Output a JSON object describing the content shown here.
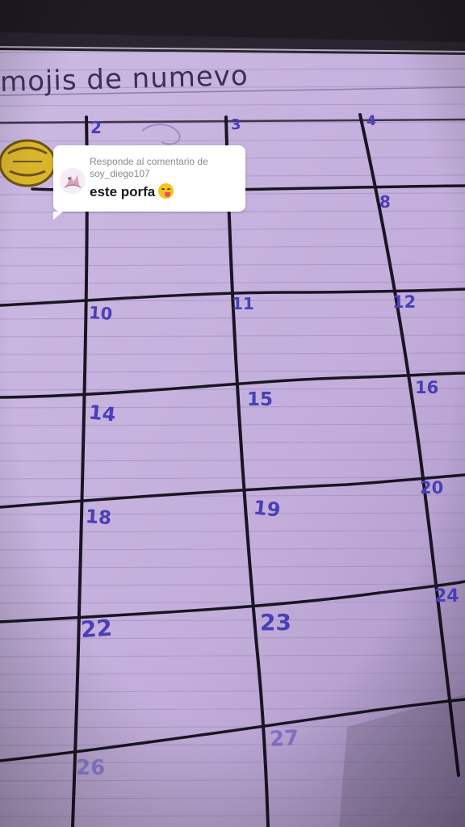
{
  "image": {
    "paper_heading": "mojis de numevo",
    "cell_numbers": [
      "2",
      "3",
      "4",
      "8",
      "10",
      "11",
      "12",
      "14",
      "15",
      "16",
      "18",
      "19",
      "20",
      "22",
      "23",
      "24",
      "26",
      "27"
    ]
  },
  "reply": {
    "header": "Responde al comentario de soy_diego107",
    "text": "este porfa",
    "emoji": "savoring-food-emoji"
  },
  "colors": {
    "paper": "#c7b3dd",
    "ink_lines": "#1a1524",
    "number_ink": "#4a3fb8",
    "card_bg": "#ffffff"
  }
}
